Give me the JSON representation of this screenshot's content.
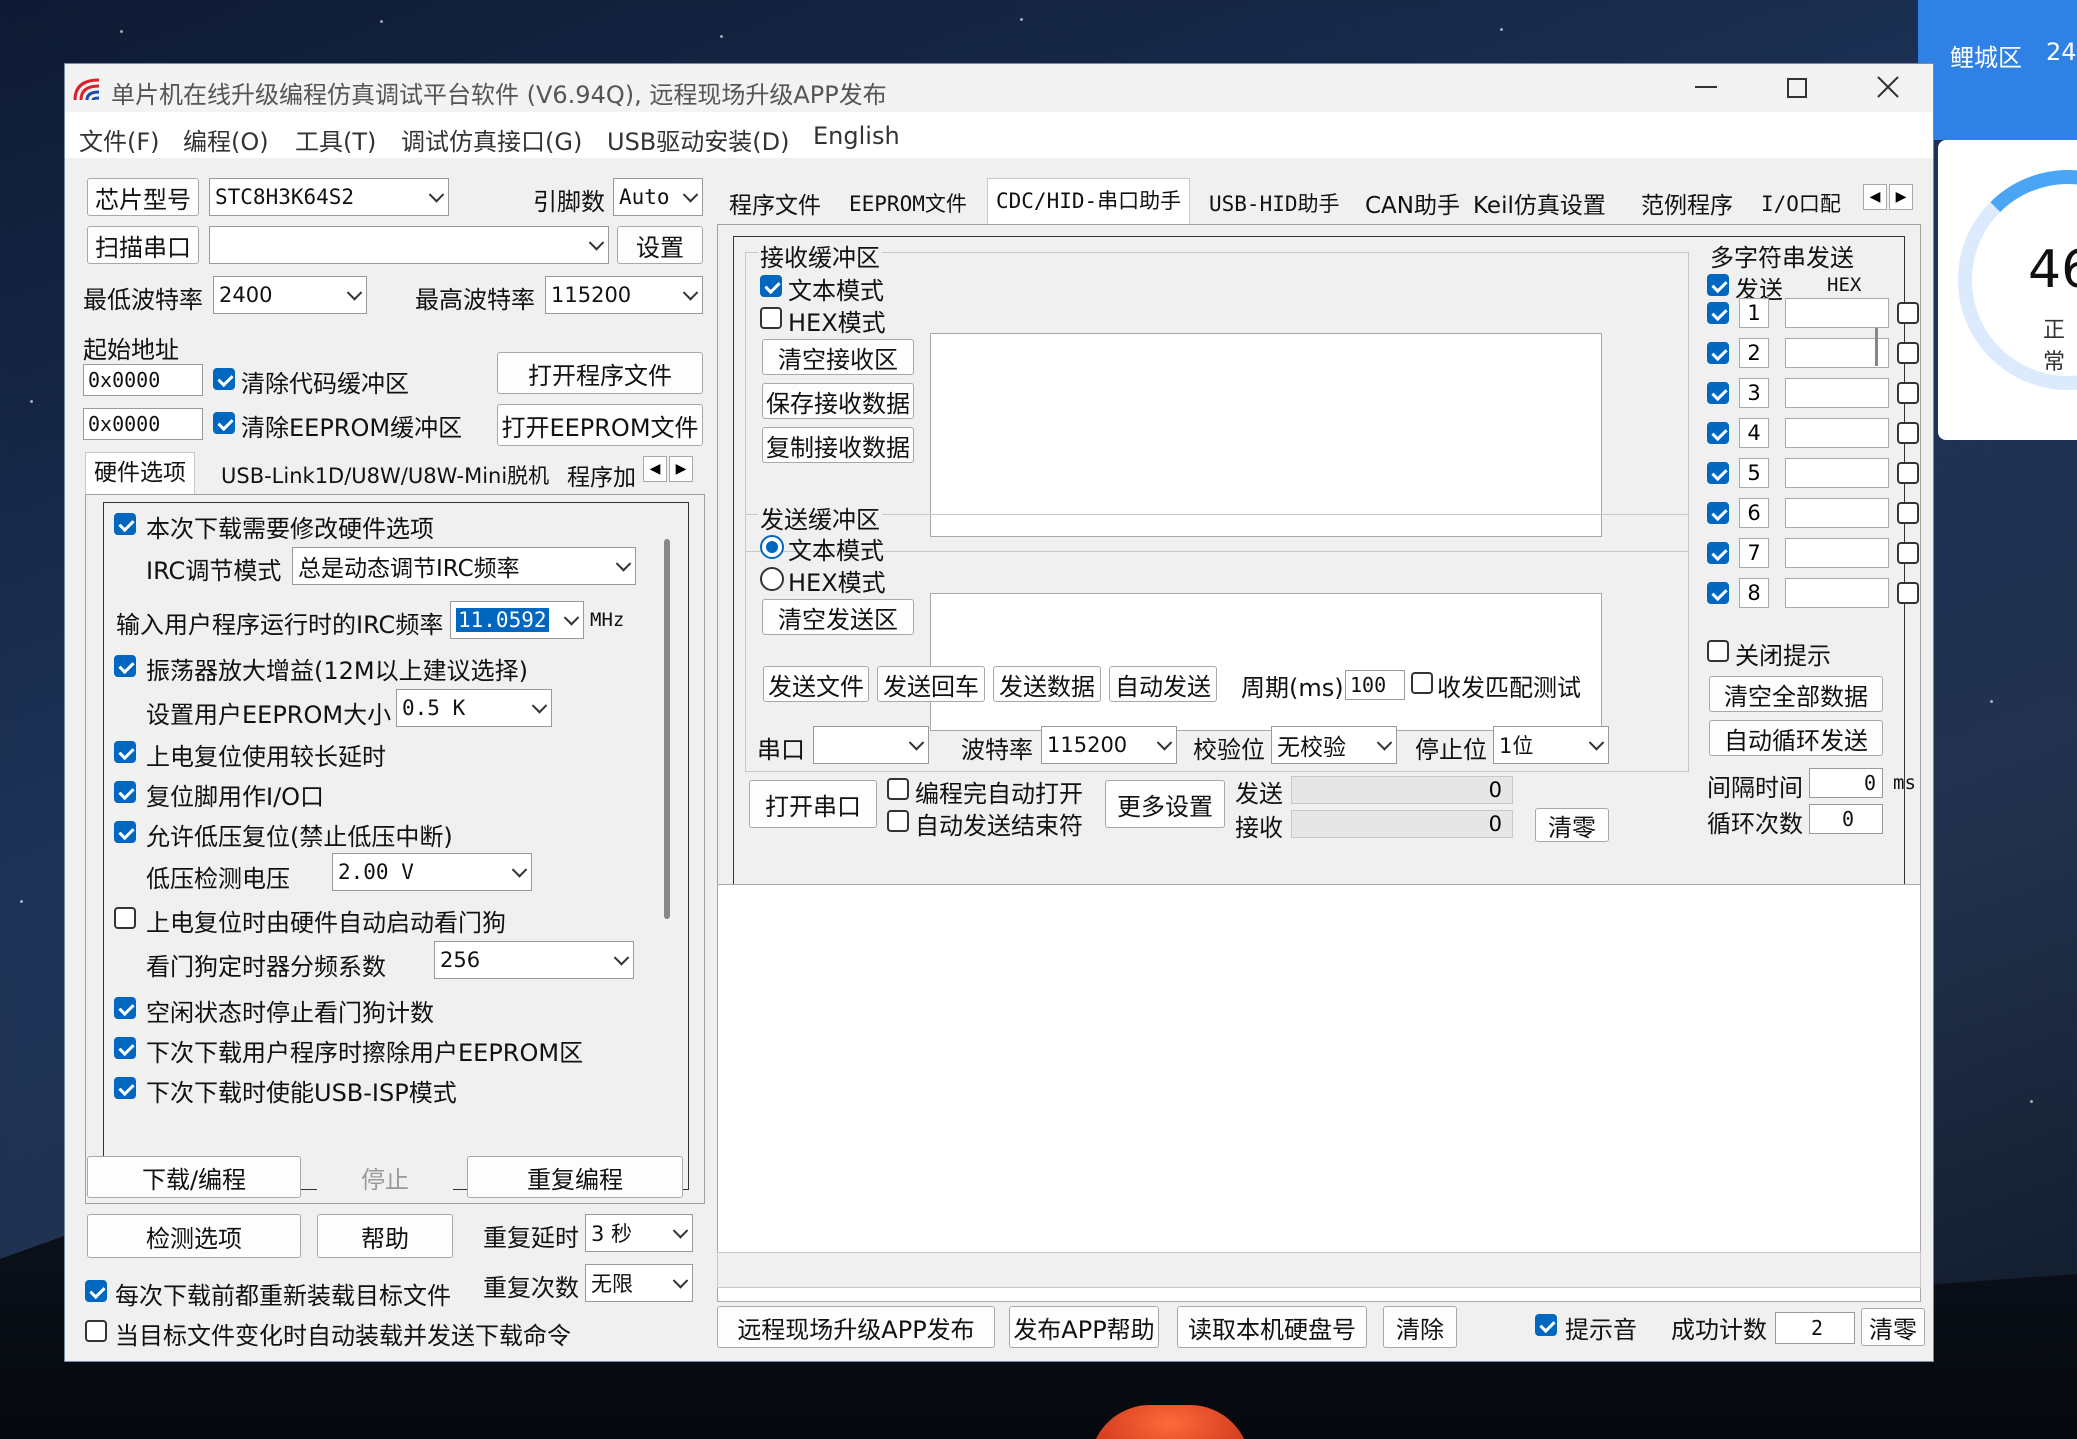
{
  "window": {
    "title": "单片机在线升级编程仿真调试平台软件 (V6.94Q), 远程现场升级APP发布"
  },
  "menu": {
    "items": [
      "文件(F)",
      "编程(O)",
      "工具(T)",
      "调试仿真接口(G)",
      "USB驱动安装(D)",
      "English"
    ]
  },
  "desktop": {
    "side_label": "鲤城区",
    "side_value": "24",
    "gauge_value": "46",
    "gauge_label": "正常"
  },
  "left": {
    "chip_model_btn": "芯片型号",
    "chip_model_value": "STC8H3K64S2",
    "pin_label": "引脚数",
    "pin_value": "Auto",
    "scan_port_btn": "扫描串口",
    "port_value": "",
    "settings_btn": "设置",
    "min_baud_label": "最低波特率",
    "min_baud_value": "2400",
    "max_baud_label": "最高波特率",
    "max_baud_value": "115200",
    "start_addr_label": "起始地址",
    "addr1": "0x0000",
    "clear_code_label": "清除代码缓冲区",
    "open_prog_btn": "打开程序文件",
    "addr2": "0x0000",
    "clear_eeprom_label": "清除EEPROM缓冲区",
    "open_eeprom_btn": "打开EEPROM文件",
    "tabs": [
      "硬件选项",
      "USB-Link1D/U8W/U8W-Mini脱机",
      "程序加"
    ],
    "options": {
      "opt1": "本次下载需要修改硬件选项",
      "irc_mode_label": "IRC调节模式",
      "irc_mode_value": "总是动态调节IRC频率",
      "irc_freq_label": "输入用户程序运行时的IRC频率",
      "irc_freq_value": "11.0592",
      "irc_freq_unit": "MHz",
      "opt2": "振荡器放大增益(12M以上建议选择)",
      "eeprom_size_label": "设置用户EEPROM大小",
      "eeprom_size_value": "0.5 K",
      "opt3": "上电复位使用较长延时",
      "opt4": "复位脚用作I/O口",
      "opt5": "允许低压复位(禁止低压中断)",
      "lv_label": "低压检测电压",
      "lv_value": "2.00 V",
      "opt6": "上电复位时由硬件自动启动看门狗",
      "wdt_label": "看门狗定时器分频系数",
      "wdt_value": "256",
      "opt7": "空闲状态时停止看门狗计数",
      "opt8": "下次下载用户程序时擦除用户EEPROM区",
      "opt9": "下次下载时使能USB-ISP模式"
    },
    "download_btn": "下载/编程",
    "stop_btn": "停止",
    "reprog_btn": "重复编程",
    "check_btn": "检测选项",
    "help_btn": "帮助",
    "repeat_delay_label": "重复延时",
    "repeat_delay_value": "3 秒",
    "repeat_count_label": "重复次数",
    "repeat_count_value": "无限",
    "reload_label": "每次下载前都重新装载目标文件",
    "auto_reload_label": "当目标文件变化时自动装载并发送下载命令"
  },
  "right": {
    "tabs": [
      "程序文件",
      "EEPROM文件",
      "CDC/HID-串口助手",
      "USB-HID助手",
      "CAN助手",
      "Keil仿真设置",
      "范例程序",
      "I/O口配"
    ],
    "recv": {
      "title": "接收缓冲区",
      "text_mode": "文本模式",
      "hex_mode": "HEX模式",
      "clear_btn": "清空接收区",
      "save_btn": "保存接收数据",
      "copy_btn": "复制接收数据"
    },
    "send": {
      "title": "发送缓冲区",
      "text_mode": "文本模式",
      "hex_mode": "HEX模式",
      "clear_btn": "清空发送区",
      "send_file_btn": "发送文件",
      "send_cr_btn": "发送回车",
      "send_data_btn": "发送数据",
      "auto_send_btn": "自动发送",
      "period_label": "周期(ms)",
      "period_value": "100",
      "match_test_label": "收发匹配测试"
    },
    "multi": {
      "title": "多字符串发送",
      "send_label": "发送",
      "hex_label": "HEX",
      "rows": [
        "1",
        "2",
        "3",
        "4",
        "5",
        "6",
        "7",
        "8"
      ],
      "close_tip_label": "关闭提示",
      "clear_all_btn": "清空全部数据",
      "auto_loop_btn": "自动循环发送",
      "interval_label": "间隔时间",
      "interval_value": "0",
      "interval_unit": "ms",
      "loop_count_label": "循环次数",
      "loop_count_value": "0"
    },
    "port": {
      "port_label": "串口",
      "port_value": "",
      "baud_label": "波特率",
      "baud_value": "115200",
      "parity_label": "校验位",
      "parity_value": "无校验",
      "stop_label": "停止位",
      "stop_value": "1位",
      "open_btn": "打开串口",
      "auto_open_label": "编程完自动打开",
      "auto_end_label": "自动发送结束符",
      "more_btn": "更多设置",
      "send_label": "发送",
      "send_count": "0",
      "recv_label": "接收",
      "recv_count": "0",
      "clear_btn": "清零"
    },
    "bottom": {
      "remote_btn": "远程现场升级APP发布",
      "publish_help_btn": "发布APP帮助",
      "read_disk_btn": "读取本机硬盘号",
      "clear_btn": "清除",
      "sound_label": "提示音",
      "success_label": "成功计数",
      "success_value": "2",
      "reset_btn": "清零"
    }
  },
  "colors": {
    "accent": "#0067c0",
    "window_bg": "#f0f0f0",
    "desktop_panel": "#2f81e6"
  }
}
